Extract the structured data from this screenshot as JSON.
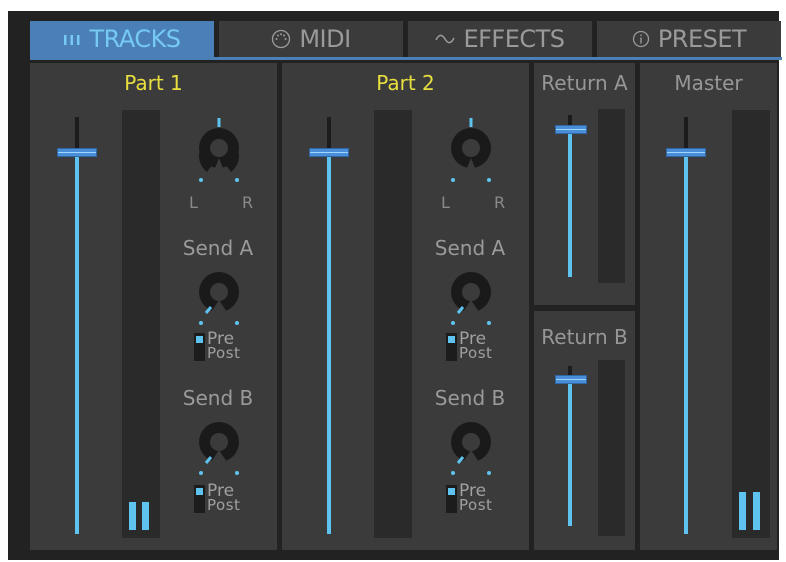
{
  "tabs": [
    {
      "label": "TRACKS",
      "icon": "tracks-icon",
      "active": true
    },
    {
      "label": "MIDI",
      "icon": "midi-icon",
      "active": false
    },
    {
      "label": "EFFECTS",
      "icon": "effects-icon",
      "active": false
    },
    {
      "label": "PRESET",
      "icon": "info-icon",
      "active": false
    }
  ],
  "parts": [
    {
      "name": "Part 1",
      "pan_left": "L",
      "pan_right": "R",
      "send_a_label": "Send A",
      "send_b_label": "Send B",
      "pre_label": "Pre",
      "post_label": "Post",
      "fader_level": 0.92
    },
    {
      "name": "Part 2",
      "pan_left": "L",
      "pan_right": "R",
      "send_a_label": "Send A",
      "send_b_label": "Send B",
      "pre_label": "Pre",
      "post_label": "Post",
      "fader_level": 0.92
    }
  ],
  "returns": [
    {
      "name": "Return A",
      "fader_level": 0.92
    },
    {
      "name": "Return B",
      "fader_level": 0.92
    }
  ],
  "master": {
    "name": "Master",
    "fader_level": 0.92
  },
  "colors": {
    "accent": "#5ec3ef",
    "active_tab": "#4a7fb7",
    "part_label": "#e8df3f",
    "panel": "#3b3b3b",
    "background": "#222222"
  }
}
